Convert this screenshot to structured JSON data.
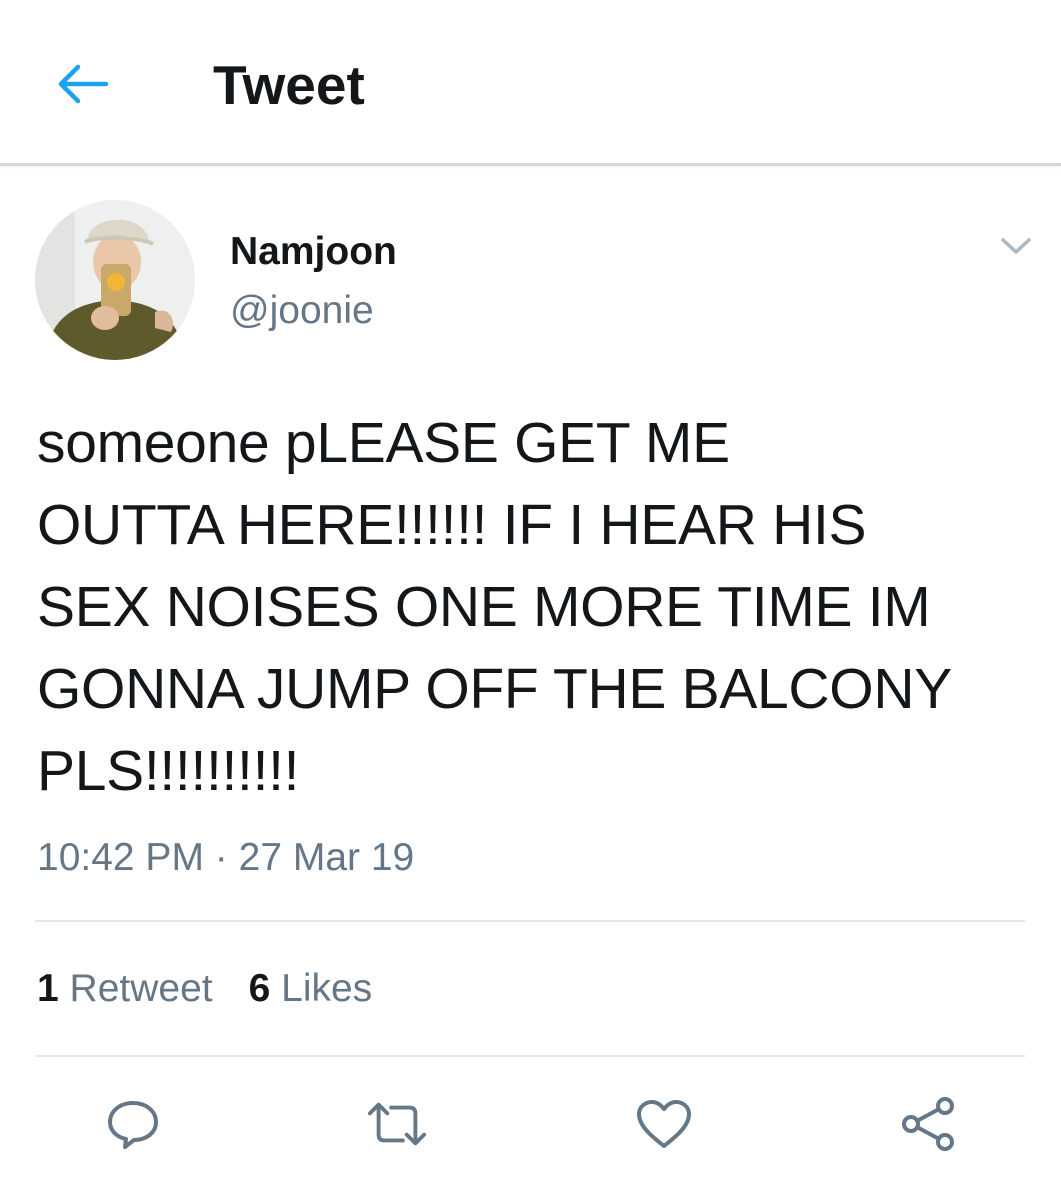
{
  "header": {
    "title": "Tweet",
    "back_icon": "arrow-left-icon"
  },
  "author": {
    "display_name": "Namjoon",
    "handle": "@joonie",
    "avatar": "profile-photo"
  },
  "tweet": {
    "text": "someone pLEASE GET ME\nOUTTA HERE!!!!!! IF I HEAR HIS\nSEX NOISES ONE MORE TIME IM\nGONNA JUMP OFF THE BALCONY\nPLS!!!!!!!!!!",
    "time": "10:42 PM",
    "separator": "·",
    "date": "27 Mar 19"
  },
  "stats": {
    "retweets_count": "1",
    "retweets_label": "Retweet",
    "likes_count": "6",
    "likes_label": "Likes"
  },
  "actions": [
    "reply-icon",
    "retweet-icon",
    "like-icon",
    "share-icon"
  ],
  "colors": {
    "accent": "#1da1f2",
    "text": "#14171a",
    "secondary": "#657786",
    "divider": "#e3e6e8"
  }
}
